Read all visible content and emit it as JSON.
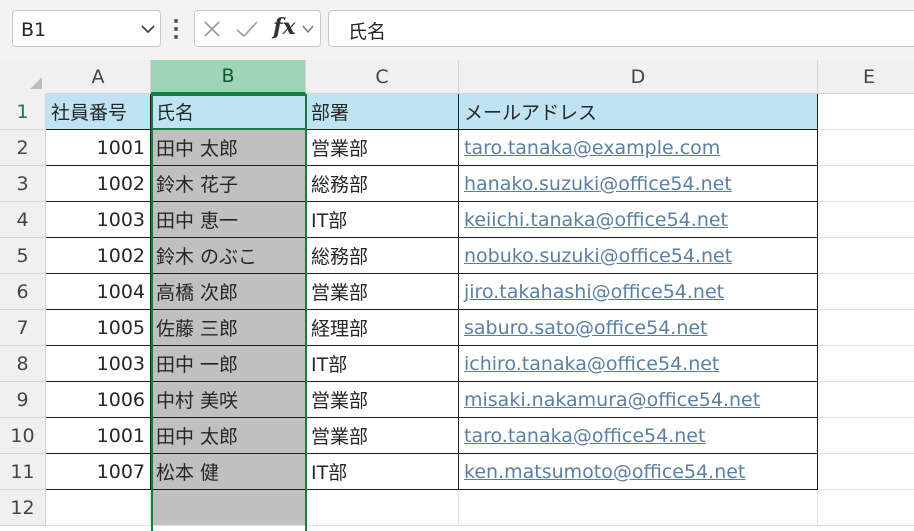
{
  "formula_bar": {
    "name_box": "B1",
    "fx_label": "fx",
    "formula": "氏名"
  },
  "icons": {
    "name_box_dropdown": "chevron-down-icon",
    "more": "vertical-ellipsis-icon",
    "cancel": "cancel-x-icon",
    "enter": "checkmark-icon",
    "function": "fx-icon"
  },
  "columns": [
    "A",
    "B",
    "C",
    "D",
    "E"
  ],
  "selected_column": "B",
  "active_cell": "B1",
  "rows": [
    "1",
    "2",
    "3",
    "4",
    "5",
    "6",
    "7",
    "8",
    "9",
    "10",
    "11",
    "12"
  ],
  "table": {
    "headers": [
      "社員番号",
      "氏名",
      "部署",
      "メールアドレス"
    ],
    "records": [
      {
        "id": "1001",
        "name": "田中 太郎",
        "dept": "営業部",
        "email": "taro.tanaka@example.com"
      },
      {
        "id": "1002",
        "name": "鈴木 花子",
        "dept": "総務部",
        "email": "hanako.suzuki@office54.net"
      },
      {
        "id": "1003",
        "name": "田中 恵一",
        "dept": "IT部",
        "email": "keiichi.tanaka@office54.net"
      },
      {
        "id": "1002",
        "name": "鈴木 のぶこ",
        "dept": "総務部",
        "email": "nobuko.suzuki@office54.net"
      },
      {
        "id": "1004",
        "name": "高橋 次郎",
        "dept": "営業部",
        "email": "jiro.takahashi@office54.net"
      },
      {
        "id": "1005",
        "name": "佐藤 三郎",
        "dept": "経理部",
        "email": "saburo.sato@office54.net"
      },
      {
        "id": "1003",
        "name": "田中 一郎",
        "dept": "IT部",
        "email": "ichiro.tanaka@office54.net"
      },
      {
        "id": "1006",
        "name": "中村 美咲",
        "dept": "営業部",
        "email": "misaki.nakamura@office54.net"
      },
      {
        "id": "1001",
        "name": "田中 太郎",
        "dept": "営業部",
        "email": "taro.tanaka@office54.net"
      },
      {
        "id": "1007",
        "name": "松本 健",
        "dept": "IT部",
        "email": "ken.matsumoto@office54.net"
      }
    ]
  },
  "colors": {
    "accent": "#137e43",
    "header_fill": "#bfe3f3",
    "selection_fill": "#c0c0c0",
    "link": "#5a7fa4"
  }
}
